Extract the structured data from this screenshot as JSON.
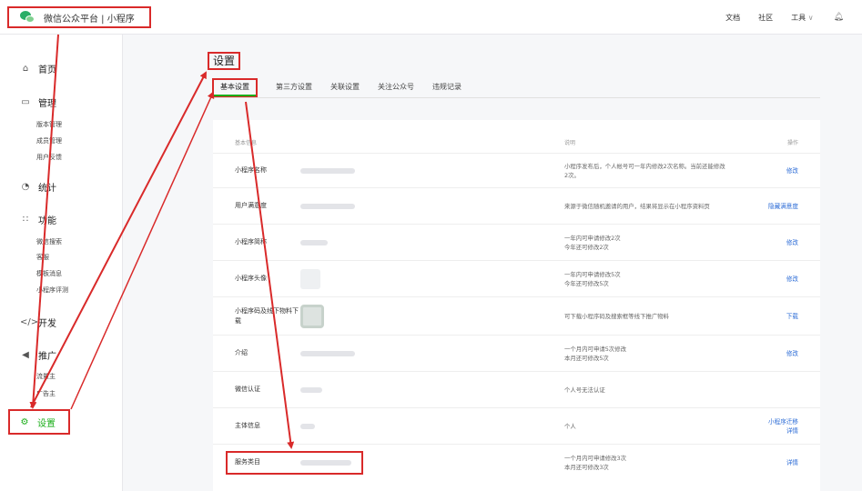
{
  "brand": {
    "title": "微信公众平台 | 小程序"
  },
  "topnav": {
    "docs": "文档",
    "community": "社区",
    "tools": "工具",
    "tools_caret": "∨"
  },
  "sidebar": {
    "home": "首页",
    "manage": "管理",
    "manage_items": [
      "版本管理",
      "成员管理",
      "用户反馈"
    ],
    "stats": "统计",
    "features": "功能",
    "feature_items": [
      "微信搜索",
      "客服",
      "模板消息",
      "小程序评测"
    ],
    "develop": "开发",
    "promote": "推广",
    "promote_items": [
      "流量主",
      "广告主"
    ],
    "settings": "设置"
  },
  "page": {
    "title": "设置"
  },
  "tabs": [
    "基本设置",
    "第三方设置",
    "关联设置",
    "关注公众号",
    "违规记录"
  ],
  "table": {
    "headers": {
      "info": "基本信息",
      "desc": "说明",
      "op": "操作"
    },
    "rows": [
      {
        "name": "小程序名称",
        "desc": "小程序发布后，个人帐号可一年内修改2次名称。当前还能修改2次。",
        "op": "修改"
      },
      {
        "name": "用户满意度",
        "desc": "来源于微信随机邀请的用户，结果将显示在小程序资料页",
        "op": "隐藏满意度"
      },
      {
        "name": "小程序简称",
        "desc": "一年内可申请修改2次\n今年还可修改2次",
        "op": "修改"
      },
      {
        "name": "小程序头像",
        "desc": "一年内可申请修改5次\n今年还可修改5次",
        "op": "修改"
      },
      {
        "name": "小程序码及线下物料下载",
        "desc": "可下载小程序码及搜索框等线下推广物料",
        "op": "下载"
      },
      {
        "name": "介绍",
        "desc": "一个月内可申请5次修改\n本月还可修改5次",
        "op": "修改"
      },
      {
        "name": "微信认证",
        "desc": "个人号无法认证",
        "op": ""
      },
      {
        "name": "主体信息",
        "desc": "个人",
        "op": "小程序迁移\n详情"
      },
      {
        "name": "服务类目",
        "desc": "一个月内可申请修改3次\n本月还可修改3次",
        "op": "详情"
      }
    ]
  },
  "colors": {
    "accent": "#1aad19",
    "highlight": "#d92a2a",
    "link": "#2b6bd6"
  }
}
